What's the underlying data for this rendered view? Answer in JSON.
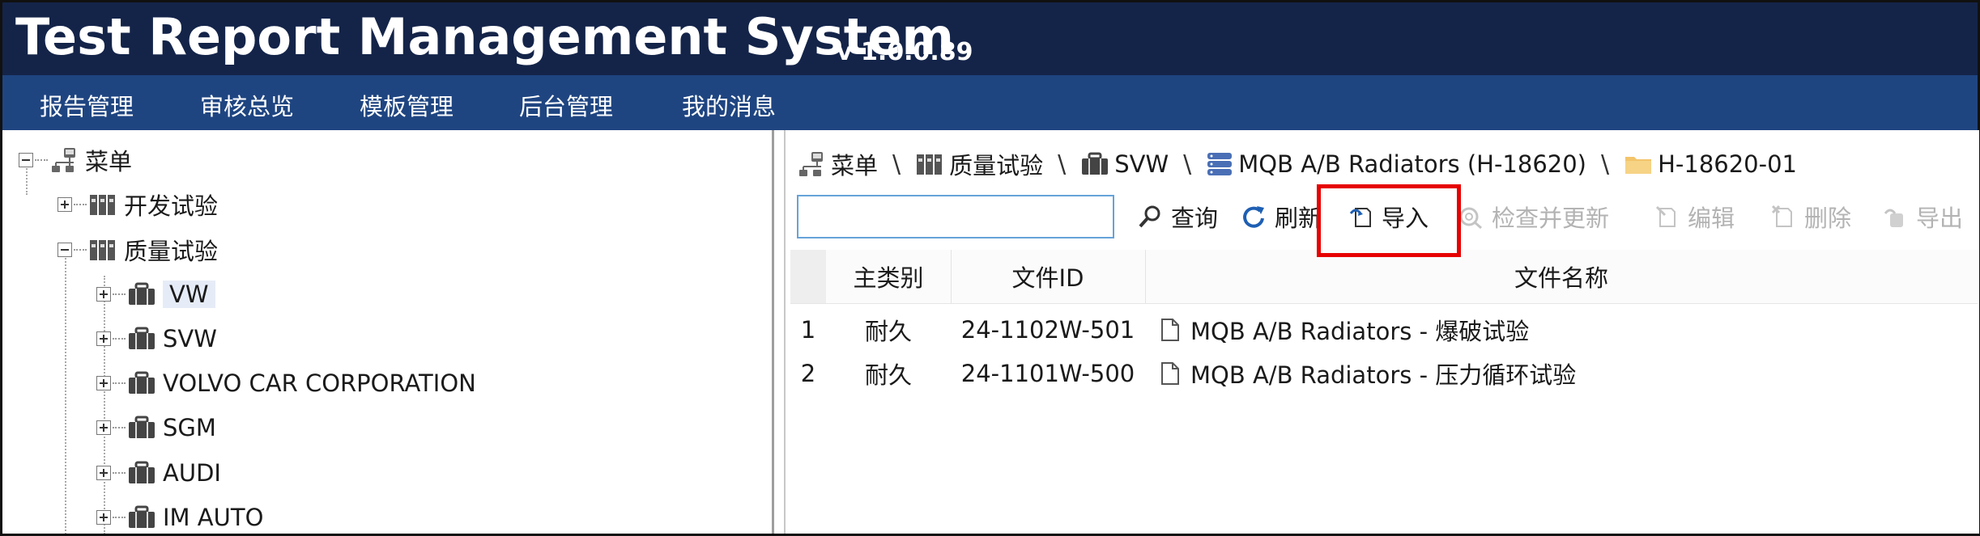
{
  "app": {
    "title": "Test Report Management System",
    "version": "v 1.0.0.89",
    "header_color": "#142449",
    "menubar_color": "#1f4581"
  },
  "menu": [
    {
      "label": "报告管理"
    },
    {
      "label": "审核总览"
    },
    {
      "label": "模板管理"
    },
    {
      "label": "后台管理"
    },
    {
      "label": "我的消息"
    }
  ],
  "tree": {
    "root": {
      "label": "菜单",
      "icon": "network-icon"
    },
    "items": [
      {
        "label": "开发试验",
        "icon": "binders-icon",
        "state": "collapsed"
      },
      {
        "label": "质量试验",
        "icon": "binders-icon",
        "state": "expanded"
      },
      {
        "label": "VW",
        "icon": "briefcase-icon",
        "state": "collapsed",
        "selected": true
      },
      {
        "label": "SVW",
        "icon": "briefcase-icon",
        "state": "collapsed"
      },
      {
        "label": "VOLVO CAR CORPORATION",
        "icon": "briefcase-icon",
        "state": "collapsed"
      },
      {
        "label": "SGM",
        "icon": "briefcase-icon",
        "state": "collapsed"
      },
      {
        "label": "AUDI",
        "icon": "briefcase-icon",
        "state": "collapsed"
      },
      {
        "label": "IM AUTO",
        "icon": "briefcase-icon",
        "state": "collapsed"
      }
    ]
  },
  "breadcrumb": {
    "items": [
      {
        "label": "菜单",
        "icon": "network-icon"
      },
      {
        "label": "质量试验",
        "icon": "binders-icon"
      },
      {
        "label": "SVW",
        "icon": "briefcase-icon"
      },
      {
        "label": "MQB A/B Radiators (H-18620)",
        "icon": "stack-icon"
      },
      {
        "label": "H-18620-01",
        "icon": "folder-icon"
      }
    ],
    "separator": "\\"
  },
  "toolbar": {
    "search": {
      "value": "",
      "placeholder": ""
    },
    "query_label": "查询",
    "refresh_label": "刷新",
    "import_label": "导入",
    "check_update_label": "检查并更新",
    "edit_label": "编辑",
    "delete_label": "删除",
    "export_label": "导出"
  },
  "table": {
    "columns": [
      "主类别",
      "文件ID",
      "文件名称"
    ],
    "rows": [
      {
        "index": "1",
        "category": "耐久",
        "file_id": "24-1102W-501",
        "file_name": "MQB A/B Radiators - 爆破试验"
      },
      {
        "index": "2",
        "category": "耐久",
        "file_id": "24-1101W-500",
        "file_name": "MQB A/B Radiators - 压力循环试验"
      }
    ]
  },
  "highlight_color": "#e60000"
}
